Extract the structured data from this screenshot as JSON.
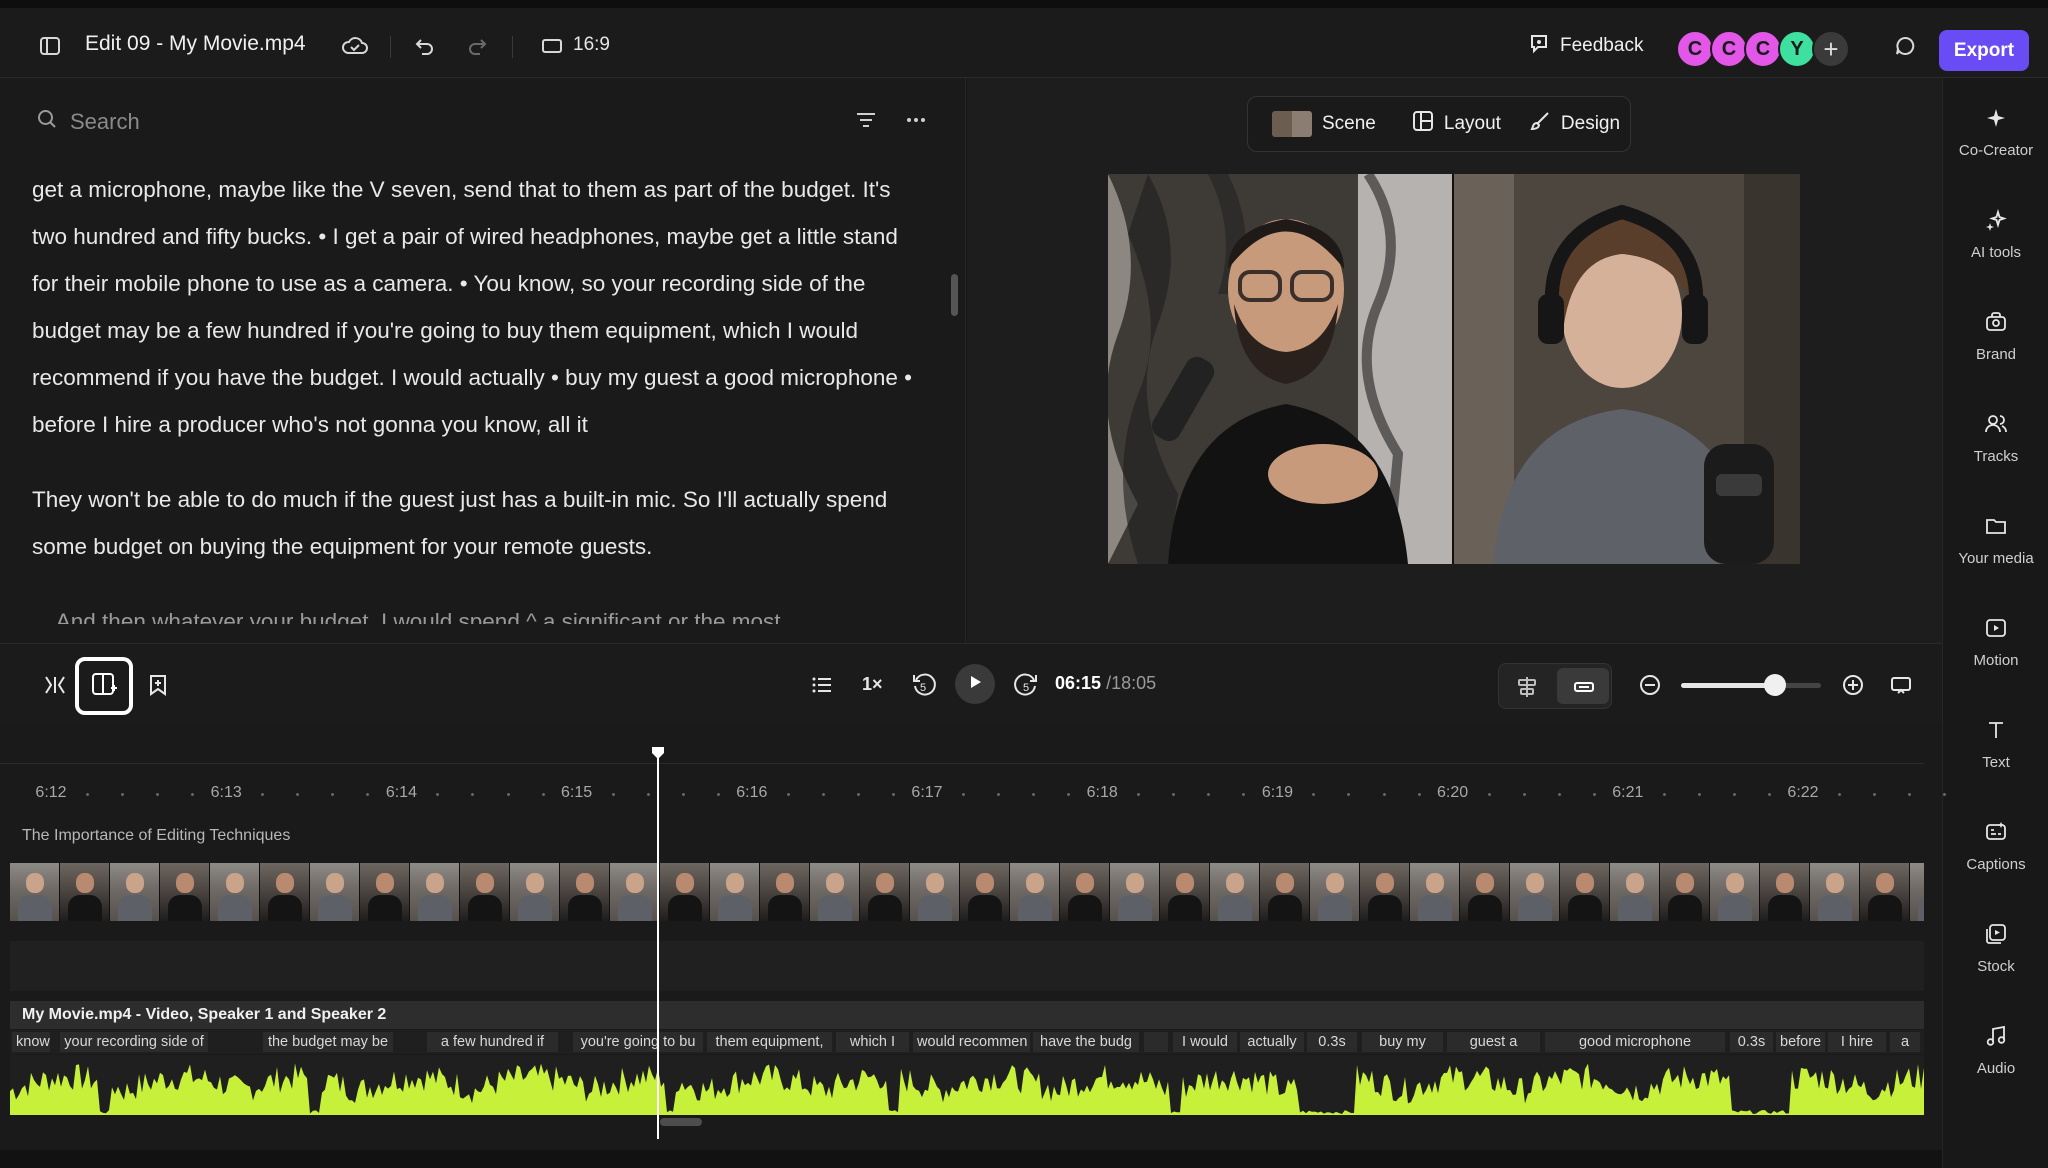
{
  "header": {
    "title": "Edit 09 - My Movie.mp4",
    "aspect_ratio": "16:9",
    "feedback_label": "Feedback",
    "export_label": "Export",
    "collaborators": [
      {
        "initial": "C",
        "color": "#e256e8"
      },
      {
        "initial": "C",
        "color": "#e256e8"
      },
      {
        "initial": "C",
        "color": "#e256e8"
      },
      {
        "initial": "Y",
        "color": "#3ee0a0"
      }
    ]
  },
  "transcript_panel": {
    "search_placeholder": "Search",
    "paragraphs": [
      "get a microphone, maybe like the V seven, send that to them as part of the budget. It's two hundred and fifty bucks. • I get a pair of wired headphones, maybe get a little stand for their mobile phone to use as a camera. • You know, so your recording side of the budget may be a few hundred if you're going to buy them equipment, which I would recommend if you have the budget. I would actually • buy my guest a good microphone • before I hire a producer who's not gonna you know, all it",
      "They won't be able to do much if the guest just has a built-in mic. So I'll actually spend some budget on buying the equipment for your remote guests.",
      "... And then whatever your budget, I would spend ^ a significant or the most"
    ]
  },
  "preview": {
    "scene_label": "Scene",
    "layout_label": "Layout",
    "design_label": "Design"
  },
  "tools": [
    {
      "label": "Co-Creator",
      "icon": "sparkle-icon"
    },
    {
      "label": "AI tools",
      "icon": "ai-sparkles-icon"
    },
    {
      "label": "Brand",
      "icon": "brand-kit-icon"
    },
    {
      "label": "Tracks",
      "icon": "people-icon"
    },
    {
      "label": "Your media",
      "icon": "folder-icon"
    },
    {
      "label": "Motion",
      "icon": "motion-icon"
    },
    {
      "label": "Text",
      "icon": "text-icon"
    },
    {
      "label": "Captions",
      "icon": "captions-icon"
    },
    {
      "label": "Stock",
      "icon": "stock-icon"
    },
    {
      "label": "Audio",
      "icon": "music-note-icon"
    }
  ],
  "playback": {
    "speed": "1×",
    "current_time": "06:15",
    "total_time": "/18:05",
    "zoom_level": 0.67
  },
  "timeline": {
    "ruler_labels": [
      "6:12",
      "6:13",
      "6:14",
      "6:15",
      "6:16",
      "6:17",
      "6:18",
      "6:19",
      "6:20",
      "6:21",
      "6:22"
    ],
    "chapter_title": "The Importance of Editing Techniques",
    "clip_title": "My Movie.mp4 - Video, Speaker 1 and Speaker 2",
    "words": [
      "know,",
      "your recording side of",
      "the budget may be",
      "a few hundred if",
      "you're going to bu",
      "them equipment,",
      "which I",
      "would recommen",
      "have the budg",
      "",
      "I would",
      "actually",
      "0.3s",
      "buy my",
      "guest a",
      "good microphone",
      "0.3s",
      "before",
      "I hire",
      "a"
    ],
    "waveform_color": "#c6f03a"
  }
}
